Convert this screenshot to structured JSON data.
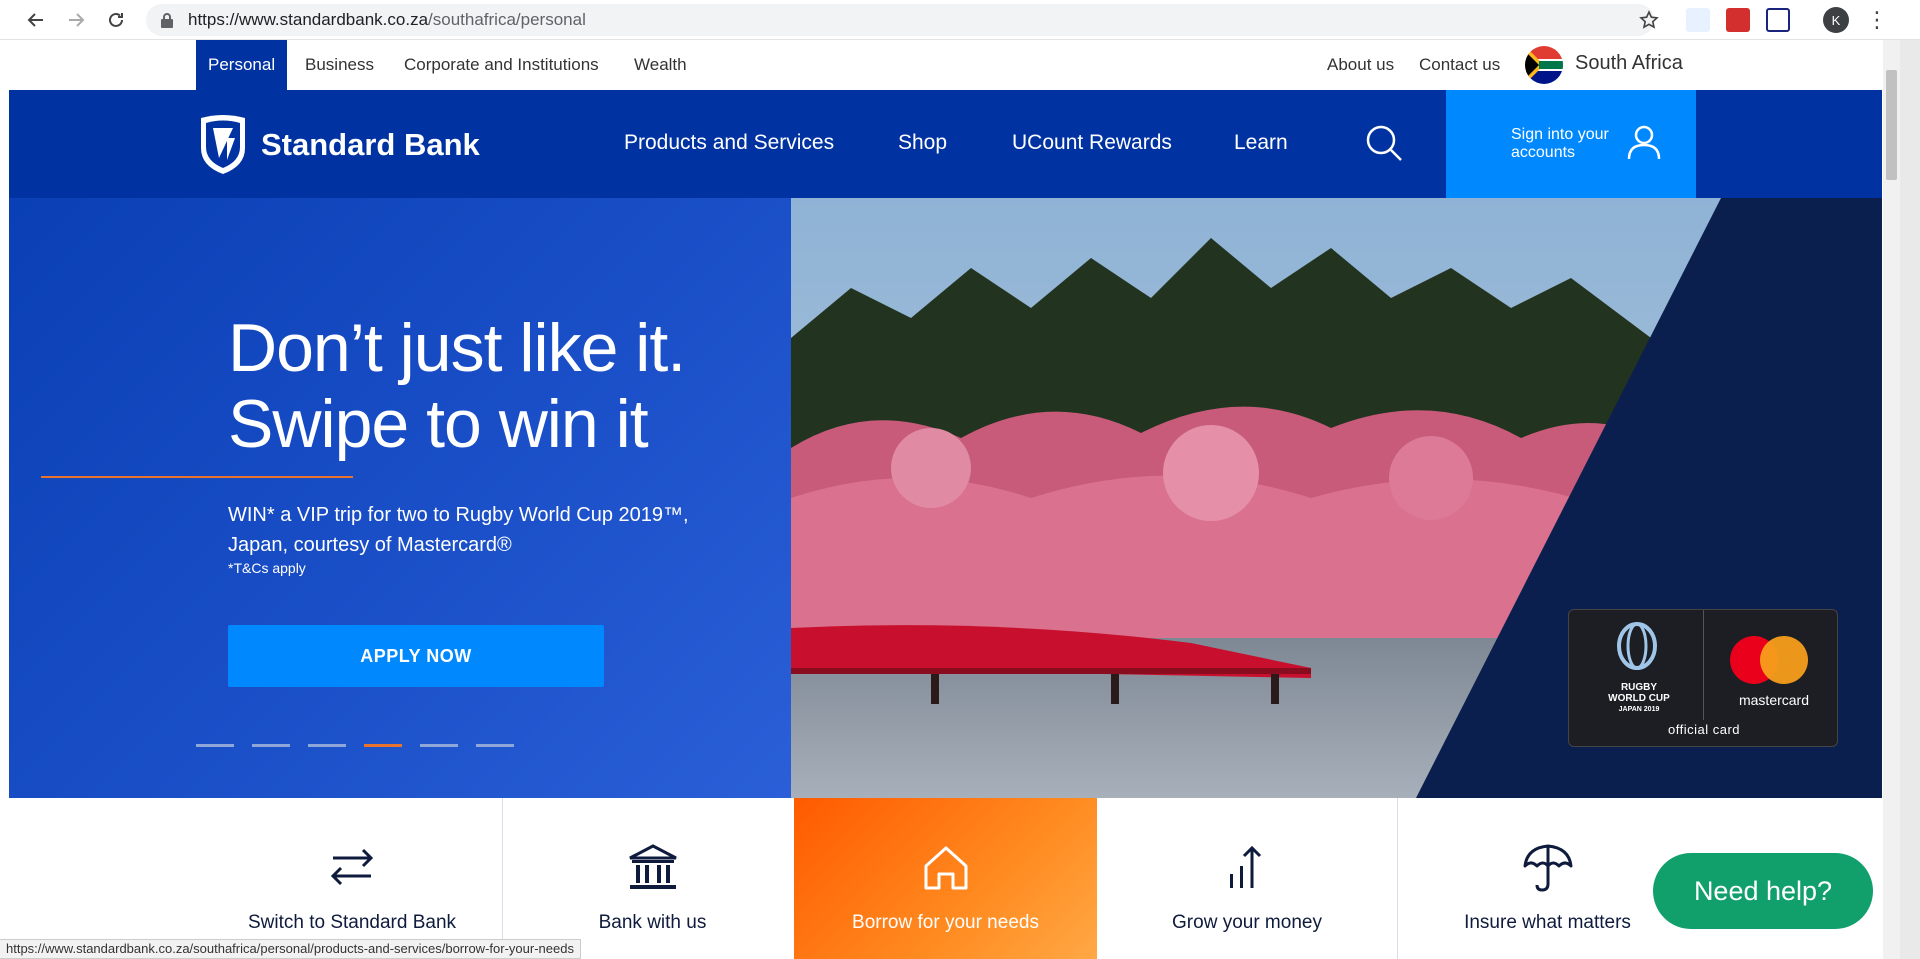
{
  "browser": {
    "url_host": "https://www.standardbank.co.za",
    "url_path": "/southafrica/personal",
    "profile_initial": "K",
    "status_url": "https://www.standardbank.co.za/southafrica/personal/products-and-services/borrow-for-your-needs"
  },
  "topnav": {
    "tabs": [
      {
        "label": "Personal",
        "active": true
      },
      {
        "label": "Business"
      },
      {
        "label": "Corporate and Institutions"
      },
      {
        "label": "Wealth"
      }
    ],
    "links": [
      {
        "label": "About us"
      },
      {
        "label": "Contact us"
      }
    ],
    "country": "South Africa"
  },
  "mainnav": {
    "brand": "Standard Bank",
    "items": [
      {
        "label": "Products and Services"
      },
      {
        "label": "Shop"
      },
      {
        "label": "UCount Rewards"
      },
      {
        "label": "Learn"
      }
    ],
    "signin_line1": "Sign into your",
    "signin_line2": "accounts"
  },
  "hero": {
    "headline_line1": "Don’t just like it.",
    "headline_line2": "Swipe to win it",
    "promo_line1": "WIN* a VIP trip for two to Rugby World Cup 2019™,",
    "promo_line2": "Japan, courtesy of Mastercard®",
    "terms": "*T&Cs apply",
    "cta": "APPLY NOW",
    "slides_total": 6,
    "slide_active": 4,
    "card": {
      "rwc_line1": "RUGBY",
      "rwc_line2": "WORLD CUP",
      "rwc_line3": "JAPAN 2019",
      "mc_label": "mastercard",
      "official": "official card"
    }
  },
  "tiles": [
    {
      "label": "Switch to Standard Bank",
      "icon": "switch-arrows-icon"
    },
    {
      "label": "Bank with us",
      "icon": "bank-building-icon"
    },
    {
      "label": "Borrow for your needs",
      "icon": "house-icon",
      "highlighted": true
    },
    {
      "label": "Grow your money",
      "icon": "growth-chart-icon"
    },
    {
      "label": "Insure what matters",
      "icon": "umbrella-icon"
    }
  ],
  "help_button": "Need help?",
  "colors": {
    "brand_blue": "#0033a1",
    "accent_blue": "#0089ff",
    "orange": "#ff5a00",
    "help_green": "#11a06c"
  }
}
